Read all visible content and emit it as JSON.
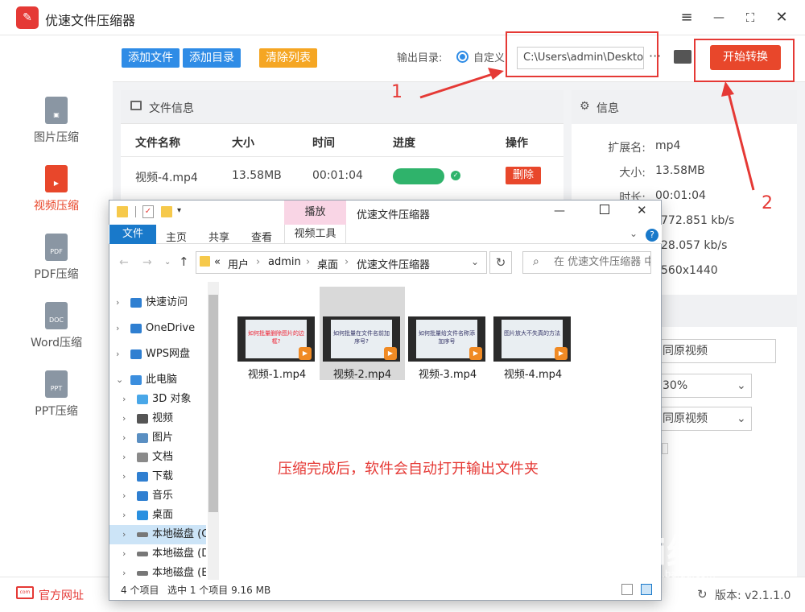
{
  "app": {
    "title": "优速文件压缩器",
    "logo_text": "✎"
  },
  "window_controls": {
    "menu": "≡",
    "minimize": "—",
    "maximize": "⛶",
    "close": "✕"
  },
  "sidebar": {
    "items": [
      {
        "label": "图片压缩",
        "icon": "image-file-icon",
        "active": false
      },
      {
        "label": "视频压缩",
        "icon": "video-file-icon",
        "active": true
      },
      {
        "label": "PDF压缩",
        "icon": "pdf-file-icon",
        "icon_text": "PDF",
        "active": false
      },
      {
        "label": "Word压缩",
        "icon": "doc-file-icon",
        "icon_text": "DOC",
        "active": false
      },
      {
        "label": "PPT压缩",
        "icon": "ppt-file-icon",
        "icon_text": "PPT",
        "active": false
      }
    ]
  },
  "toolbar": {
    "add_file": "添加文件",
    "add_folder": "添加目录",
    "clear_list": "清除列表",
    "output_label": "输出目录:",
    "custom_label": "自定义",
    "output_path": "C:\\Users\\admin\\Desktop",
    "more": "···",
    "start": "开始转换"
  },
  "file_panel": {
    "title": "文件信息",
    "columns": [
      "文件名称",
      "大小",
      "时间",
      "进度",
      "操作"
    ],
    "rows": [
      {
        "name": "视频-4.mp4",
        "size": "13.58MB",
        "time": "00:01:04",
        "progress": 1.0,
        "action": "删除"
      }
    ]
  },
  "info_panel": {
    "title": "信息",
    "fields": [
      {
        "key": "扩展名:",
        "value": "mp4"
      },
      {
        "key": "大小:",
        "value": "13.58MB"
      },
      {
        "key": "时长:",
        "value": "00:01:04"
      },
      {
        "key": "",
        "value": "772.851 kb/s"
      },
      {
        "key": "",
        "value": "28.057 kb/s"
      },
      {
        "key": "",
        "value": "560x1440"
      }
    ],
    "selects": [
      "同原视频",
      "30%",
      "同原视频"
    ]
  },
  "footer": {
    "site_icon_text": "com",
    "site_link": "官方网址",
    "version": "版本: v2.1.1.0"
  },
  "explorer": {
    "title": "优速文件压缩器",
    "ribbon_tabs": [
      "文件",
      "主页",
      "共享",
      "查看"
    ],
    "play_tab": "播放",
    "video_tools": "视频工具",
    "breadcrumb": [
      "«",
      "用户",
      "admin",
      "桌面",
      "优速文件压缩器"
    ],
    "search_placeholder": "在 优速文件压缩器 中搜索",
    "nav": [
      {
        "label": "快速访问",
        "icon": "star-icon",
        "color": "#2f7fd1"
      },
      {
        "label": "OneDrive",
        "icon": "cloud-icon",
        "color": "#2f7fd1"
      },
      {
        "label": "WPS网盘",
        "icon": "cloud-icon",
        "color": "#2f7fd1"
      },
      {
        "label": "此电脑",
        "icon": "computer-icon",
        "color": "#3b8ede"
      },
      {
        "label": "3D 对象",
        "icon": "cube-icon",
        "color": "#49a7e8"
      },
      {
        "label": "视频",
        "icon": "film-icon",
        "color": "#555555"
      },
      {
        "label": "图片",
        "icon": "picture-icon",
        "color": "#5a8fc2"
      },
      {
        "label": "文档",
        "icon": "document-icon",
        "color": "#8a8a8a"
      },
      {
        "label": "下载",
        "icon": "download-icon",
        "color": "#2f7fd1"
      },
      {
        "label": "音乐",
        "icon": "music-icon",
        "color": "#2f7fd1"
      },
      {
        "label": "桌面",
        "icon": "desktop-icon",
        "color": "#2a90e0"
      },
      {
        "label": "本地磁盘 (C:)",
        "icon": "drive-icon",
        "color": "#777777"
      },
      {
        "label": "本地磁盘 (D:)",
        "icon": "drive-icon",
        "color": "#777777"
      },
      {
        "label": "本地磁盘 (E:)",
        "icon": "drive-icon",
        "color": "#777777"
      }
    ],
    "files": [
      {
        "name": "视频-1.mp4",
        "caption": "如何批量删除图片的边框?"
      },
      {
        "name": "视频-2.mp4",
        "caption": "如何批量在文件名前加序号?"
      },
      {
        "name": "视频-3.mp4",
        "caption": "如何批量给文件名称添加序号"
      },
      {
        "name": "视频-4.mp4",
        "caption": "图片放大不失真的方法"
      }
    ],
    "note": "压缩完成后，软件会自动打开输出文件夹",
    "status_items": "4 个项目",
    "status_selected": "选中 1 个项目  9.16 MB"
  },
  "annotations": {
    "one": "1",
    "two": "2"
  },
  "watermark": {
    "main": "Bai经验",
    "sub": "jingyan.baidu.com"
  },
  "colors": {
    "accent": "#e8472b",
    "blue": "#2f8ce6",
    "orange": "#f5a623",
    "green": "#2fb36b",
    "annotation": "#e53935"
  }
}
